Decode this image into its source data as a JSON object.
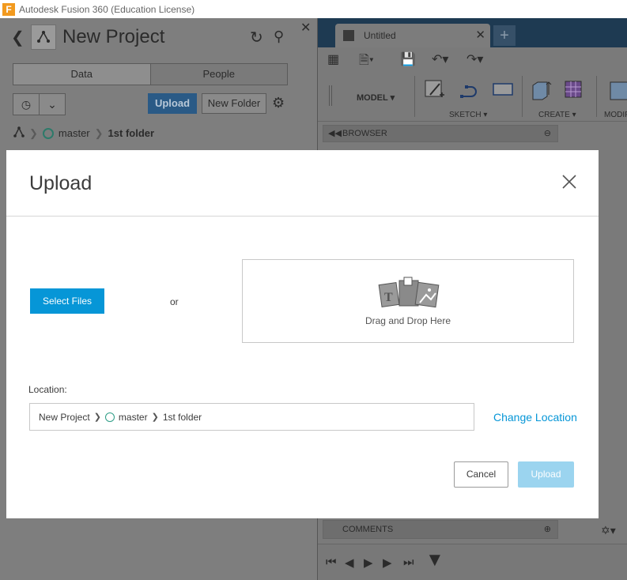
{
  "window": {
    "title": "Autodesk Fusion 360 (Education License)",
    "app_icon_letter": "F"
  },
  "data_panel": {
    "title": "New Project",
    "tabs": [
      {
        "label": "Data",
        "active": true
      },
      {
        "label": "People",
        "active": false
      }
    ],
    "upload_label": "Upload",
    "new_folder_label": "New Folder",
    "breadcrumb": {
      "branch": "master",
      "folder": "1st folder"
    }
  },
  "fusion": {
    "document_tab": "Untitled",
    "workspace": "MODEL",
    "toolbar_groups": [
      "SKETCH",
      "CREATE",
      "MODIFY"
    ],
    "browser_label": "BROWSER",
    "comments_label": "COMMENTS"
  },
  "modal": {
    "title": "Upload",
    "select_files_label": "Select Files",
    "or_label": "or",
    "drop_text": "Drag and Drop Here",
    "location_label": "Location:",
    "location": {
      "project": "New Project",
      "branch": "master",
      "folder": "1st folder"
    },
    "change_location_label": "Change Location",
    "cancel_label": "Cancel",
    "upload_label": "Upload"
  },
  "colors": {
    "accent": "#0696d7",
    "upload_disabled": "#9bd4ef",
    "branch_circle": "#2d9d86",
    "overlay_dim": "#808080"
  }
}
